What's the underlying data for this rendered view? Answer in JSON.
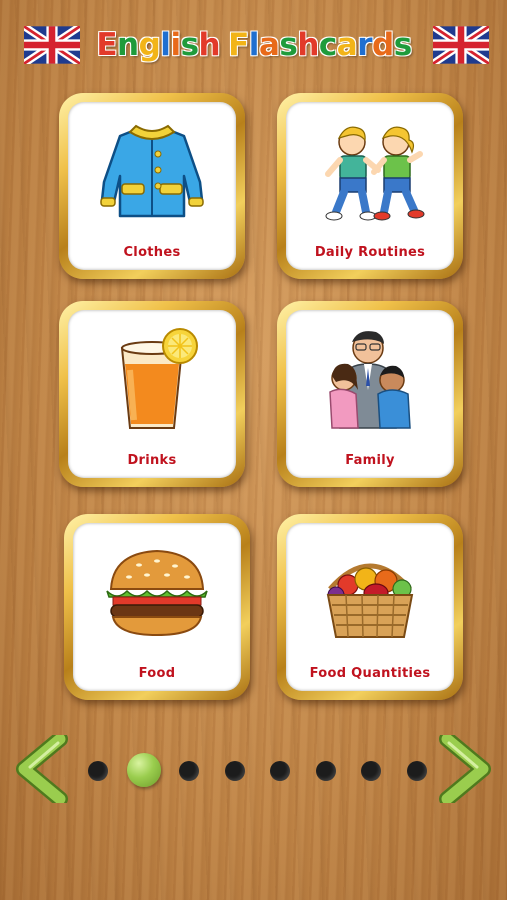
{
  "header": {
    "title": "English Flashcards",
    "left_flag_icon": "uk-flag-icon",
    "right_flag_icon": "uk-flag-icon"
  },
  "categories": [
    {
      "label": "Clothes",
      "icon": "coat-icon"
    },
    {
      "label": "Daily Routines",
      "icon": "kids-walking-icon"
    },
    {
      "label": "Drinks",
      "icon": "juice-glass-icon"
    },
    {
      "label": "Family",
      "icon": "family-hug-icon"
    },
    {
      "label": "Food",
      "icon": "burger-icon"
    },
    {
      "label": "Food Quantities",
      "icon": "fruit-basket-icon"
    }
  ],
  "pagination": {
    "page_count": 8,
    "current_page": 2,
    "prev_icon": "chevron-left-icon",
    "next_icon": "chevron-right-icon",
    "active_color": "#9acd4e",
    "dot_color": "#1c1c1c"
  },
  "colors": {
    "label": "#c0121e",
    "frame_gold": "#e0aa30",
    "wood": "#c58a4c"
  }
}
